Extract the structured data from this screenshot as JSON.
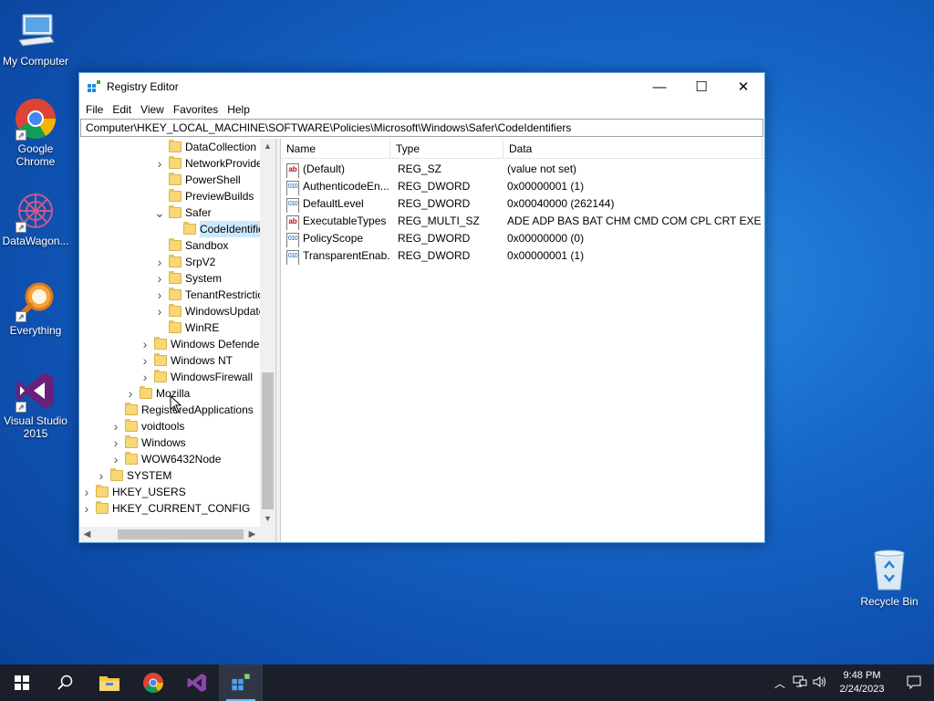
{
  "desktop": {
    "icons": [
      {
        "label": "My Computer"
      },
      {
        "label": "Google Chrome"
      },
      {
        "label": "DataWagon..."
      },
      {
        "label": "Everything"
      },
      {
        "label": "Visual Studio 2015"
      }
    ],
    "recycle_bin": {
      "label": "Recycle Bin"
    }
  },
  "window": {
    "title": "Registry Editor",
    "controls": {
      "minimize": "—",
      "maximize": "☐",
      "close": "✕"
    },
    "menu": [
      "File",
      "Edit",
      "View",
      "Favorites",
      "Help"
    ],
    "address": "Computer\\HKEY_LOCAL_MACHINE\\SOFTWARE\\Policies\\Microsoft\\Windows\\Safer\\CodeIdentifiers",
    "tree": [
      {
        "label": "DataCollection",
        "expander": "none"
      },
      {
        "label": "NetworkProvider",
        "expander": "collapsed"
      },
      {
        "label": "PowerShell",
        "expander": "none"
      },
      {
        "label": "PreviewBuilds",
        "expander": "none"
      },
      {
        "label": "Safer",
        "expander": "expanded"
      },
      {
        "label": "CodeIdentifiers",
        "expander": "none",
        "selected": true
      },
      {
        "label": "Sandbox",
        "expander": "none"
      },
      {
        "label": "SrpV2",
        "expander": "collapsed"
      },
      {
        "label": "System",
        "expander": "collapsed"
      },
      {
        "label": "TenantRestrictions",
        "expander": "collapsed"
      },
      {
        "label": "WindowsUpdate",
        "expander": "collapsed"
      },
      {
        "label": "WinRE",
        "expander": "none"
      },
      {
        "label": "Windows Defender",
        "expander": "collapsed"
      },
      {
        "label": "Windows NT",
        "expander": "collapsed"
      },
      {
        "label": "WindowsFirewall",
        "expander": "collapsed"
      },
      {
        "label": "Mozilla",
        "expander": "collapsed"
      },
      {
        "label": "RegisteredApplications",
        "expander": "none"
      },
      {
        "label": "voidtools",
        "expander": "collapsed"
      },
      {
        "label": "Windows",
        "expander": "collapsed"
      },
      {
        "label": "WOW6432Node",
        "expander": "collapsed"
      },
      {
        "label": "SYSTEM",
        "expander": "collapsed"
      },
      {
        "label": "HKEY_USERS",
        "expander": "collapsed"
      },
      {
        "label": "HKEY_CURRENT_CONFIG",
        "expander": "collapsed"
      }
    ],
    "columns": {
      "name": "Name",
      "type": "Type",
      "data": "Data"
    },
    "values": [
      {
        "name": "(Default)",
        "type": "REG_SZ",
        "data": "(value not set)",
        "icon": "string-value-icon"
      },
      {
        "name": "AuthenticodeEn...",
        "type": "REG_DWORD",
        "data": "0x00000001 (1)",
        "icon": "dword-value-icon"
      },
      {
        "name": "DefaultLevel",
        "type": "REG_DWORD",
        "data": "0x00040000 (262144)",
        "icon": "dword-value-icon"
      },
      {
        "name": "ExecutableTypes",
        "type": "REG_MULTI_SZ",
        "data": "ADE ADP BAS BAT CHM CMD COM CPL CRT EXE ...",
        "icon": "string-value-icon"
      },
      {
        "name": "PolicyScope",
        "type": "REG_DWORD",
        "data": "0x00000000 (0)",
        "icon": "dword-value-icon"
      },
      {
        "name": "TransparentEnab...",
        "type": "REG_DWORD",
        "data": "0x00000001 (1)",
        "icon": "dword-value-icon"
      }
    ]
  },
  "taskbar": {
    "time": "9:48 PM",
    "date": "2/24/2023"
  }
}
